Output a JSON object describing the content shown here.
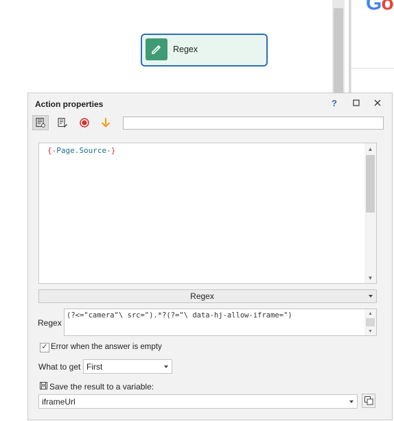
{
  "background": {
    "logo_letters": [
      "G",
      "o"
    ],
    "logo_colors": {
      "g": "#4285f4",
      "o": "#ea4335"
    }
  },
  "node": {
    "label": "Regex",
    "icon": "pencil-icon",
    "accent": "#3e9b76",
    "border": "#2f6db6"
  },
  "panel": {
    "title": "Action properties",
    "help": "?",
    "toolbar": {
      "tools": [
        "properties-icon",
        "edit-note-icon",
        "record-icon",
        "arrow-down-icon"
      ],
      "search_value": ""
    },
    "editor": {
      "brace_open": "{-",
      "variable": "Page.Source",
      "brace_close": "-}"
    },
    "mode": {
      "value": "Regex"
    },
    "regex": {
      "label": "Regex",
      "value": "(?<=\"camera\"\\ src=\").*?(?=\"\\ data-hj-allow-iframe=\")"
    },
    "error_option": {
      "checked": true,
      "label": "Error  when the answer is empty"
    },
    "what_to_get": {
      "label": "What to get",
      "value": "First"
    },
    "save": {
      "label": "Save the result to a variable:",
      "value": "iframeUrl"
    }
  }
}
